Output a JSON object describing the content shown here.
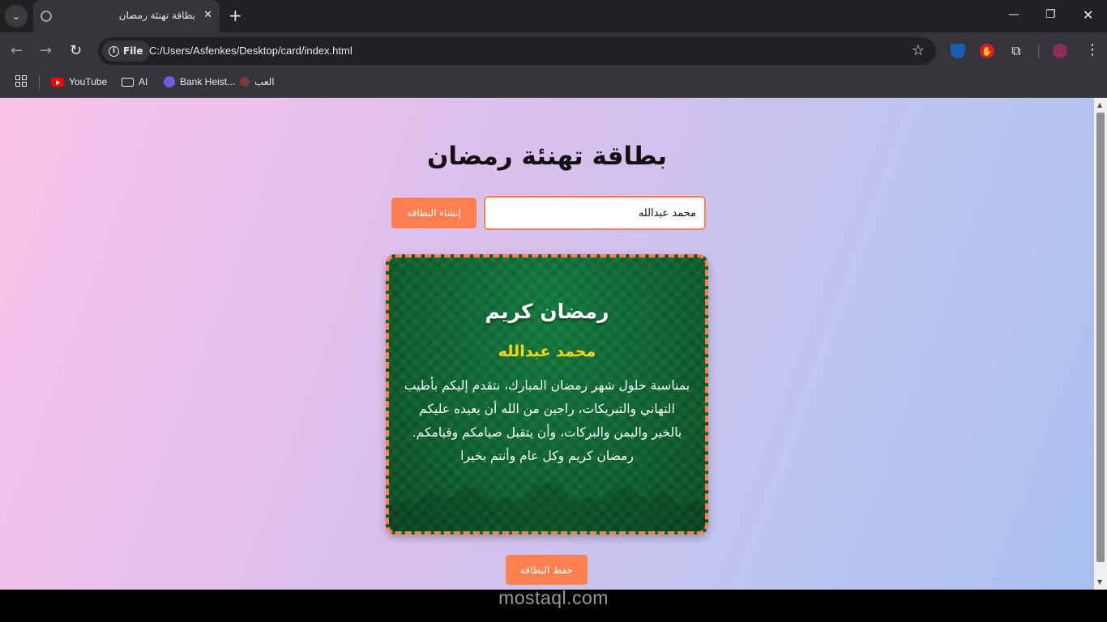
{
  "browser": {
    "tab_title": "بطاقة تهنئة رمضان",
    "site_chip_label": "File",
    "url": "C:/Users/Asfenkes/Desktop/card/index.html",
    "bookmarks": [
      {
        "label": "YouTube",
        "icon": "youtube-icon"
      },
      {
        "label": "AI",
        "icon": "folder-icon"
      },
      {
        "label": "Bank Heist...",
        "icon": "bank-heist-icon"
      },
      {
        "label": "العب",
        "icon": "game-icon"
      }
    ]
  },
  "page": {
    "title": "بطاقة تهنئة رمضان",
    "generate_button": "إنشاء البطاقة",
    "name_input_value": "محمد عبدالله",
    "save_button": "حفظ البطاقة"
  },
  "card": {
    "heading": "رمضان كريم",
    "name": "محمد عبدالله",
    "message": "بمناسبة حلول شهر رمضان المبارك، نتقدم إليكم بأطيب التهاني والتبريكات، راجين من الله أن يعيده عليكم بالخير واليمن والبركات، وأن يتقبل صيامكم وقيامكم. رمضان كريم وكل عام وأنتم بخيرا"
  },
  "watermark": "mostaql.com",
  "colors": {
    "accent": "#ff7f50",
    "card_green": "#0c5f2e",
    "name_gold": "#ffd700"
  }
}
